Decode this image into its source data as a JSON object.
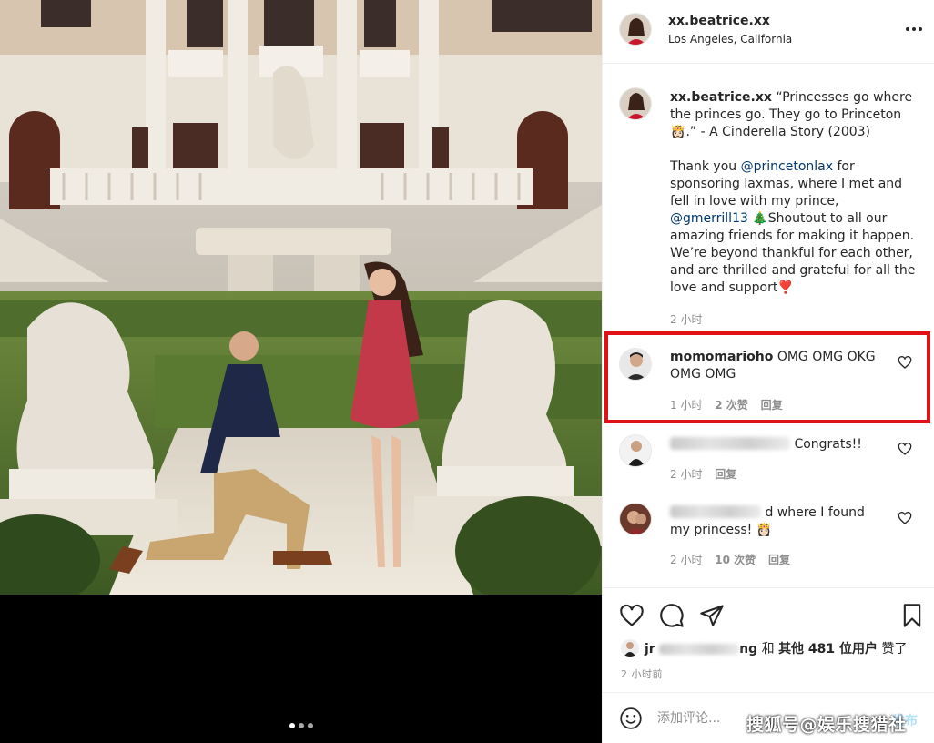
{
  "post": {
    "username": "xx.beatrice.xx",
    "location": "Los Angeles, California"
  },
  "caption": {
    "username": "xx.beatrice.xx",
    "line1_text": "“Princesses go where the princes go. They go to Princeton",
    "line1_emoji": "👸🏻",
    "line1_after": ".” - A Cinderella Story (2003)",
    "p2_a": "Thank you ",
    "mention1": "@princetonlax",
    "p2_b": " for sponsoring laxmas, where I met and fell in love with my prince,",
    "mention2": "@gmerrill13",
    "tree_emoji": "🎄",
    "p2_c": "Shoutout to all our amazing friends for making it happen. We’re beyond thankful for each other, and are thrilled and grateful for all the love and support",
    "heart_emoji": "❣️",
    "time": "2 小时"
  },
  "comments": [
    {
      "username": "momomarioho",
      "text": "OMG OMG OKG OMG OMG",
      "time": "1 小时",
      "likes": "2 次赞",
      "reply": "回复"
    },
    {
      "text": "Congrats!!",
      "time": "2 小时",
      "reply": "回复"
    },
    {
      "text_a": "d where I found my princess!",
      "emoji": "👸🏻",
      "time": "2 小时",
      "likes": "10 次赞",
      "reply": "回复"
    }
  ],
  "likes": {
    "liker_visible_start": "jr",
    "liker_visible_end": "ng",
    "connector": "和",
    "others": "其他 481 位用户",
    "suffix": "赞了"
  },
  "posted_time": "2 小时前",
  "comment_box": {
    "placeholder": "添加评论...",
    "post_label": "发布"
  },
  "watermark": "搜狐号@娱乐搜猎社",
  "colors": {
    "highlight": "#e01218",
    "mention": "#00376b",
    "muted": "#8e8e8e",
    "text": "#262626"
  },
  "carousel": {
    "count": 3,
    "active_index": 0
  }
}
